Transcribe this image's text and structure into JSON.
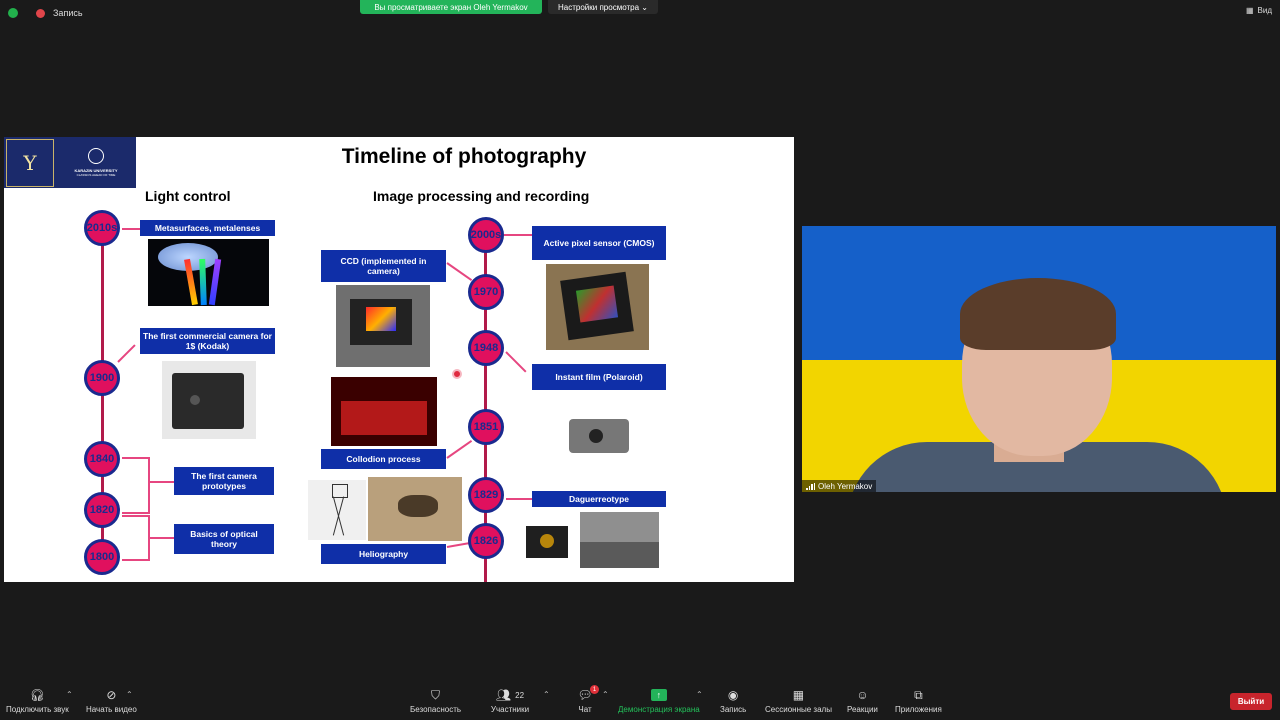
{
  "topbar": {
    "recording_label": "Запись",
    "sharing_text": "Вы просматриваете экран Oleh Yermakov",
    "view_options_label": "Настройки просмотра",
    "view_label": "Вид"
  },
  "slide": {
    "title": "Timeline of photography",
    "section_left": "Light control",
    "section_right": "Image processing and recording",
    "logo_text": "KARAZIN UNIVERSITY",
    "logo_subtext": "CLASSICS AHEAD OF TIME",
    "years_left": [
      "2010s",
      "1900",
      "1840",
      "1820",
      "1800"
    ],
    "years_right": [
      "2000s",
      "1970",
      "1948",
      "1851",
      "1829",
      "1826"
    ],
    "labels": {
      "metasurfaces": "Metasurfaces, metalenses",
      "kodak": "The first commercial camera for 1$ (Kodak)",
      "prototypes": "The first camera prototypes",
      "optical": "Basics of optical theory",
      "ccd": "CCD (implemented in camera)",
      "collodion": "Collodion process",
      "heliography": "Heliography",
      "cmos": "Active pixel sensor (CMOS)",
      "polaroid": "Instant film (Polaroid)",
      "daguerreotype": "Daguerreotype"
    }
  },
  "video": {
    "participant_name": "Oleh Yermakov",
    "flag_colors": [
      "#1560c9",
      "#f2d500"
    ]
  },
  "toolbar": {
    "audio": "Подключить звук",
    "video": "Начать видео",
    "security": "Безопасность",
    "participants": "Участники",
    "participants_count": "22",
    "chat": "Чат",
    "chat_badge": "1",
    "share": "Демонстрация экрана",
    "record": "Запись",
    "breakout": "Сессионные залы",
    "reactions": "Реакции",
    "apps": "Приложения",
    "leave": "Выйти"
  }
}
